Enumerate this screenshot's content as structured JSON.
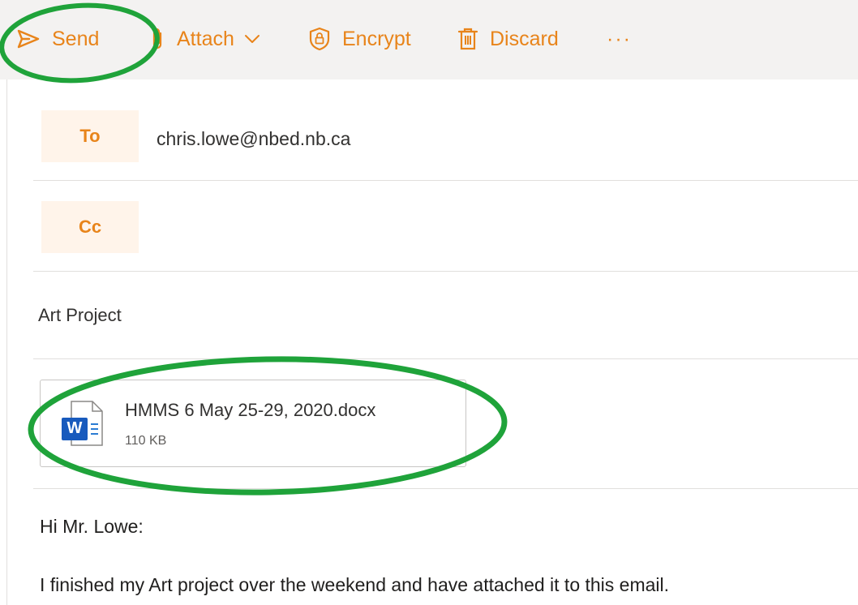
{
  "toolbar": {
    "send_label": "Send",
    "attach_label": "Attach",
    "encrypt_label": "Encrypt",
    "discard_label": "Discard",
    "more_label": "···"
  },
  "recipients": {
    "to_label": "To",
    "to_value": "chris.lowe@nbed.nb.ca",
    "cc_label": "Cc",
    "cc_value": ""
  },
  "subject": "Art Project",
  "attachment": {
    "file_name": "HMMS 6 May 25-29, 2020.docx",
    "file_size": "110 KB",
    "icon": "word-document-icon",
    "icon_letter": "W"
  },
  "body": {
    "greeting": "Hi Mr. Lowe:",
    "line1": "I finished my Art project over the weekend and have attached it to this email."
  },
  "colors": {
    "accent": "#e8841a",
    "chip_bg": "#fff4ea",
    "annotation": "#1fa33a",
    "word_blue": "#185abd"
  }
}
